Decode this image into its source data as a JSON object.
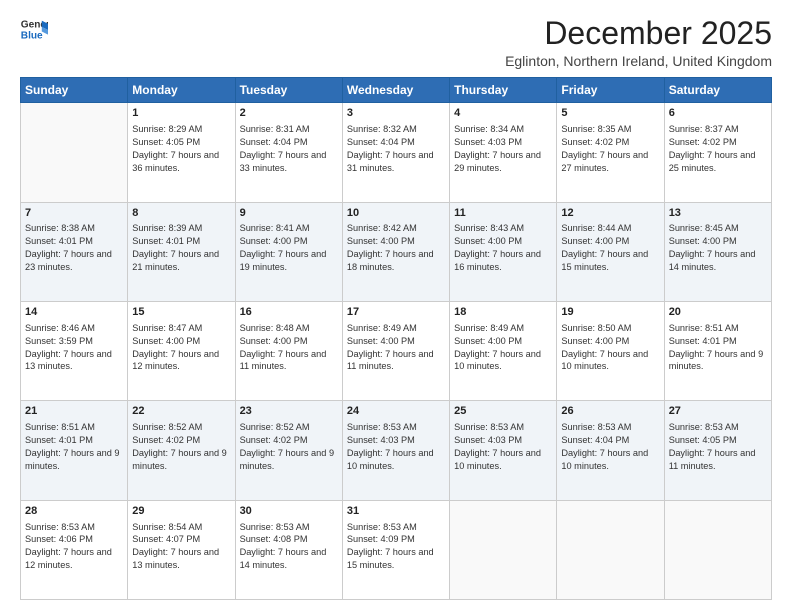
{
  "logo": {
    "line1": "General",
    "line2": "Blue"
  },
  "header": {
    "month": "December 2025",
    "subtitle": "Eglinton, Northern Ireland, United Kingdom"
  },
  "weekdays": [
    "Sunday",
    "Monday",
    "Tuesday",
    "Wednesday",
    "Thursday",
    "Friday",
    "Saturday"
  ],
  "weeks": [
    [
      {
        "day": "",
        "sunrise": "",
        "sunset": "",
        "daylight": ""
      },
      {
        "day": "1",
        "sunrise": "Sunrise: 8:29 AM",
        "sunset": "Sunset: 4:05 PM",
        "daylight": "Daylight: 7 hours and 36 minutes."
      },
      {
        "day": "2",
        "sunrise": "Sunrise: 8:31 AM",
        "sunset": "Sunset: 4:04 PM",
        "daylight": "Daylight: 7 hours and 33 minutes."
      },
      {
        "day": "3",
        "sunrise": "Sunrise: 8:32 AM",
        "sunset": "Sunset: 4:04 PM",
        "daylight": "Daylight: 7 hours and 31 minutes."
      },
      {
        "day": "4",
        "sunrise": "Sunrise: 8:34 AM",
        "sunset": "Sunset: 4:03 PM",
        "daylight": "Daylight: 7 hours and 29 minutes."
      },
      {
        "day": "5",
        "sunrise": "Sunrise: 8:35 AM",
        "sunset": "Sunset: 4:02 PM",
        "daylight": "Daylight: 7 hours and 27 minutes."
      },
      {
        "day": "6",
        "sunrise": "Sunrise: 8:37 AM",
        "sunset": "Sunset: 4:02 PM",
        "daylight": "Daylight: 7 hours and 25 minutes."
      }
    ],
    [
      {
        "day": "7",
        "sunrise": "Sunrise: 8:38 AM",
        "sunset": "Sunset: 4:01 PM",
        "daylight": "Daylight: 7 hours and 23 minutes."
      },
      {
        "day": "8",
        "sunrise": "Sunrise: 8:39 AM",
        "sunset": "Sunset: 4:01 PM",
        "daylight": "Daylight: 7 hours and 21 minutes."
      },
      {
        "day": "9",
        "sunrise": "Sunrise: 8:41 AM",
        "sunset": "Sunset: 4:00 PM",
        "daylight": "Daylight: 7 hours and 19 minutes."
      },
      {
        "day": "10",
        "sunrise": "Sunrise: 8:42 AM",
        "sunset": "Sunset: 4:00 PM",
        "daylight": "Daylight: 7 hours and 18 minutes."
      },
      {
        "day": "11",
        "sunrise": "Sunrise: 8:43 AM",
        "sunset": "Sunset: 4:00 PM",
        "daylight": "Daylight: 7 hours and 16 minutes."
      },
      {
        "day": "12",
        "sunrise": "Sunrise: 8:44 AM",
        "sunset": "Sunset: 4:00 PM",
        "daylight": "Daylight: 7 hours and 15 minutes."
      },
      {
        "day": "13",
        "sunrise": "Sunrise: 8:45 AM",
        "sunset": "Sunset: 4:00 PM",
        "daylight": "Daylight: 7 hours and 14 minutes."
      }
    ],
    [
      {
        "day": "14",
        "sunrise": "Sunrise: 8:46 AM",
        "sunset": "Sunset: 3:59 PM",
        "daylight": "Daylight: 7 hours and 13 minutes."
      },
      {
        "day": "15",
        "sunrise": "Sunrise: 8:47 AM",
        "sunset": "Sunset: 4:00 PM",
        "daylight": "Daylight: 7 hours and 12 minutes."
      },
      {
        "day": "16",
        "sunrise": "Sunrise: 8:48 AM",
        "sunset": "Sunset: 4:00 PM",
        "daylight": "Daylight: 7 hours and 11 minutes."
      },
      {
        "day": "17",
        "sunrise": "Sunrise: 8:49 AM",
        "sunset": "Sunset: 4:00 PM",
        "daylight": "Daylight: 7 hours and 11 minutes."
      },
      {
        "day": "18",
        "sunrise": "Sunrise: 8:49 AM",
        "sunset": "Sunset: 4:00 PM",
        "daylight": "Daylight: 7 hours and 10 minutes."
      },
      {
        "day": "19",
        "sunrise": "Sunrise: 8:50 AM",
        "sunset": "Sunset: 4:00 PM",
        "daylight": "Daylight: 7 hours and 10 minutes."
      },
      {
        "day": "20",
        "sunrise": "Sunrise: 8:51 AM",
        "sunset": "Sunset: 4:01 PM",
        "daylight": "Daylight: 7 hours and 9 minutes."
      }
    ],
    [
      {
        "day": "21",
        "sunrise": "Sunrise: 8:51 AM",
        "sunset": "Sunset: 4:01 PM",
        "daylight": "Daylight: 7 hours and 9 minutes."
      },
      {
        "day": "22",
        "sunrise": "Sunrise: 8:52 AM",
        "sunset": "Sunset: 4:02 PM",
        "daylight": "Daylight: 7 hours and 9 minutes."
      },
      {
        "day": "23",
        "sunrise": "Sunrise: 8:52 AM",
        "sunset": "Sunset: 4:02 PM",
        "daylight": "Daylight: 7 hours and 9 minutes."
      },
      {
        "day": "24",
        "sunrise": "Sunrise: 8:53 AM",
        "sunset": "Sunset: 4:03 PM",
        "daylight": "Daylight: 7 hours and 10 minutes."
      },
      {
        "day": "25",
        "sunrise": "Sunrise: 8:53 AM",
        "sunset": "Sunset: 4:03 PM",
        "daylight": "Daylight: 7 hours and 10 minutes."
      },
      {
        "day": "26",
        "sunrise": "Sunrise: 8:53 AM",
        "sunset": "Sunset: 4:04 PM",
        "daylight": "Daylight: 7 hours and 10 minutes."
      },
      {
        "day": "27",
        "sunrise": "Sunrise: 8:53 AM",
        "sunset": "Sunset: 4:05 PM",
        "daylight": "Daylight: 7 hours and 11 minutes."
      }
    ],
    [
      {
        "day": "28",
        "sunrise": "Sunrise: 8:53 AM",
        "sunset": "Sunset: 4:06 PM",
        "daylight": "Daylight: 7 hours and 12 minutes."
      },
      {
        "day": "29",
        "sunrise": "Sunrise: 8:54 AM",
        "sunset": "Sunset: 4:07 PM",
        "daylight": "Daylight: 7 hours and 13 minutes."
      },
      {
        "day": "30",
        "sunrise": "Sunrise: 8:53 AM",
        "sunset": "Sunset: 4:08 PM",
        "daylight": "Daylight: 7 hours and 14 minutes."
      },
      {
        "day": "31",
        "sunrise": "Sunrise: 8:53 AM",
        "sunset": "Sunset: 4:09 PM",
        "daylight": "Daylight: 7 hours and 15 minutes."
      },
      {
        "day": "",
        "sunrise": "",
        "sunset": "",
        "daylight": ""
      },
      {
        "day": "",
        "sunrise": "",
        "sunset": "",
        "daylight": ""
      },
      {
        "day": "",
        "sunrise": "",
        "sunset": "",
        "daylight": ""
      }
    ]
  ]
}
